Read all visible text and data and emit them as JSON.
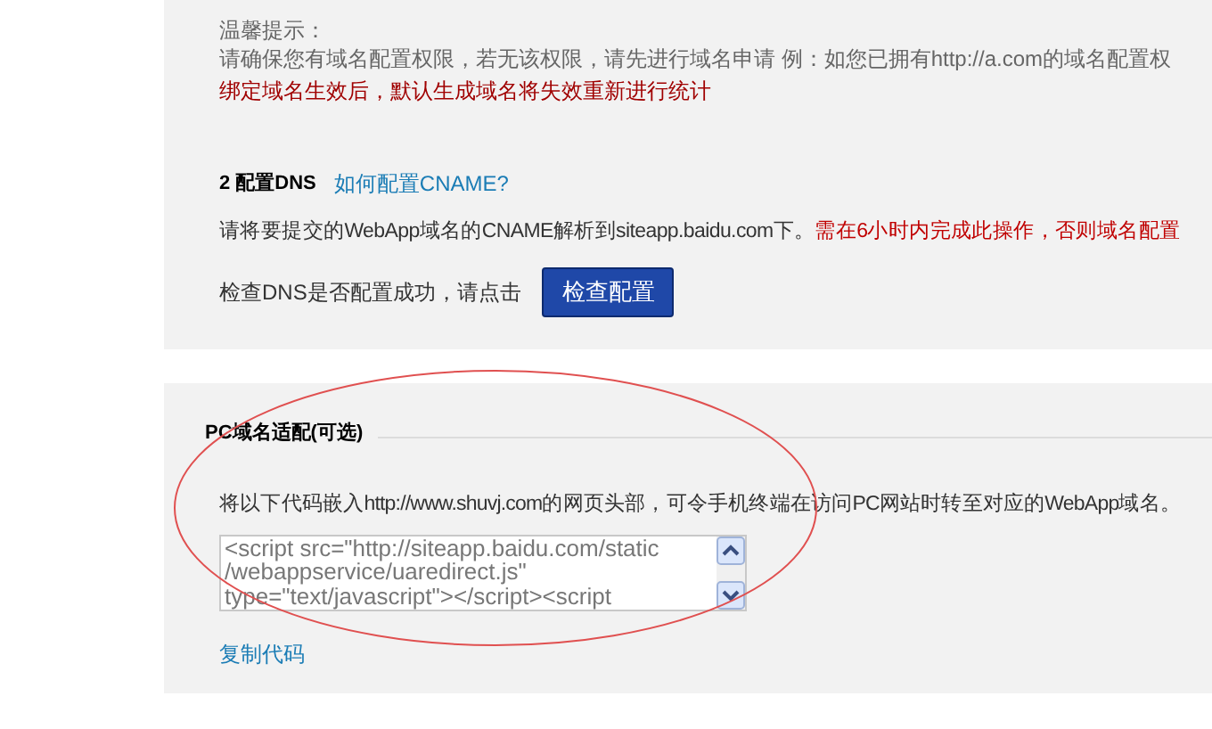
{
  "tip": {
    "title": "温馨提示：",
    "text": "请确保您有域名配置权限，若无该权限，请先进行域名申请 例：如您已拥有http://a.com的域名配置权",
    "warning": "绑定域名生效后，默认生成域名将失效重新进行统计"
  },
  "dns": {
    "heading": "2 配置DNS",
    "help_link": "如何配置CNAME?",
    "text": "请将要提交的WebApp域名的CNAME解析到siteapp.baidu.com下。",
    "warning": "需在6小时内完成此操作，否则域名配置",
    "check_text": "检查DNS是否配置成功，请点击",
    "check_button": "检查配置"
  },
  "pc_adapt": {
    "heading": "PC域名适配(可选)",
    "text": "将以下代码嵌入http://www.shuvj.com的网页头部，可令手机终端在访问PC网站时转至对应的WebApp域名。",
    "code_lines": [
      "<script src=\"http://siteapp.baidu.com/static",
      "/webappservice/uaredirect.js\"",
      "type=\"text/javascript\"></script><script"
    ],
    "copy_link": "复制代码"
  }
}
